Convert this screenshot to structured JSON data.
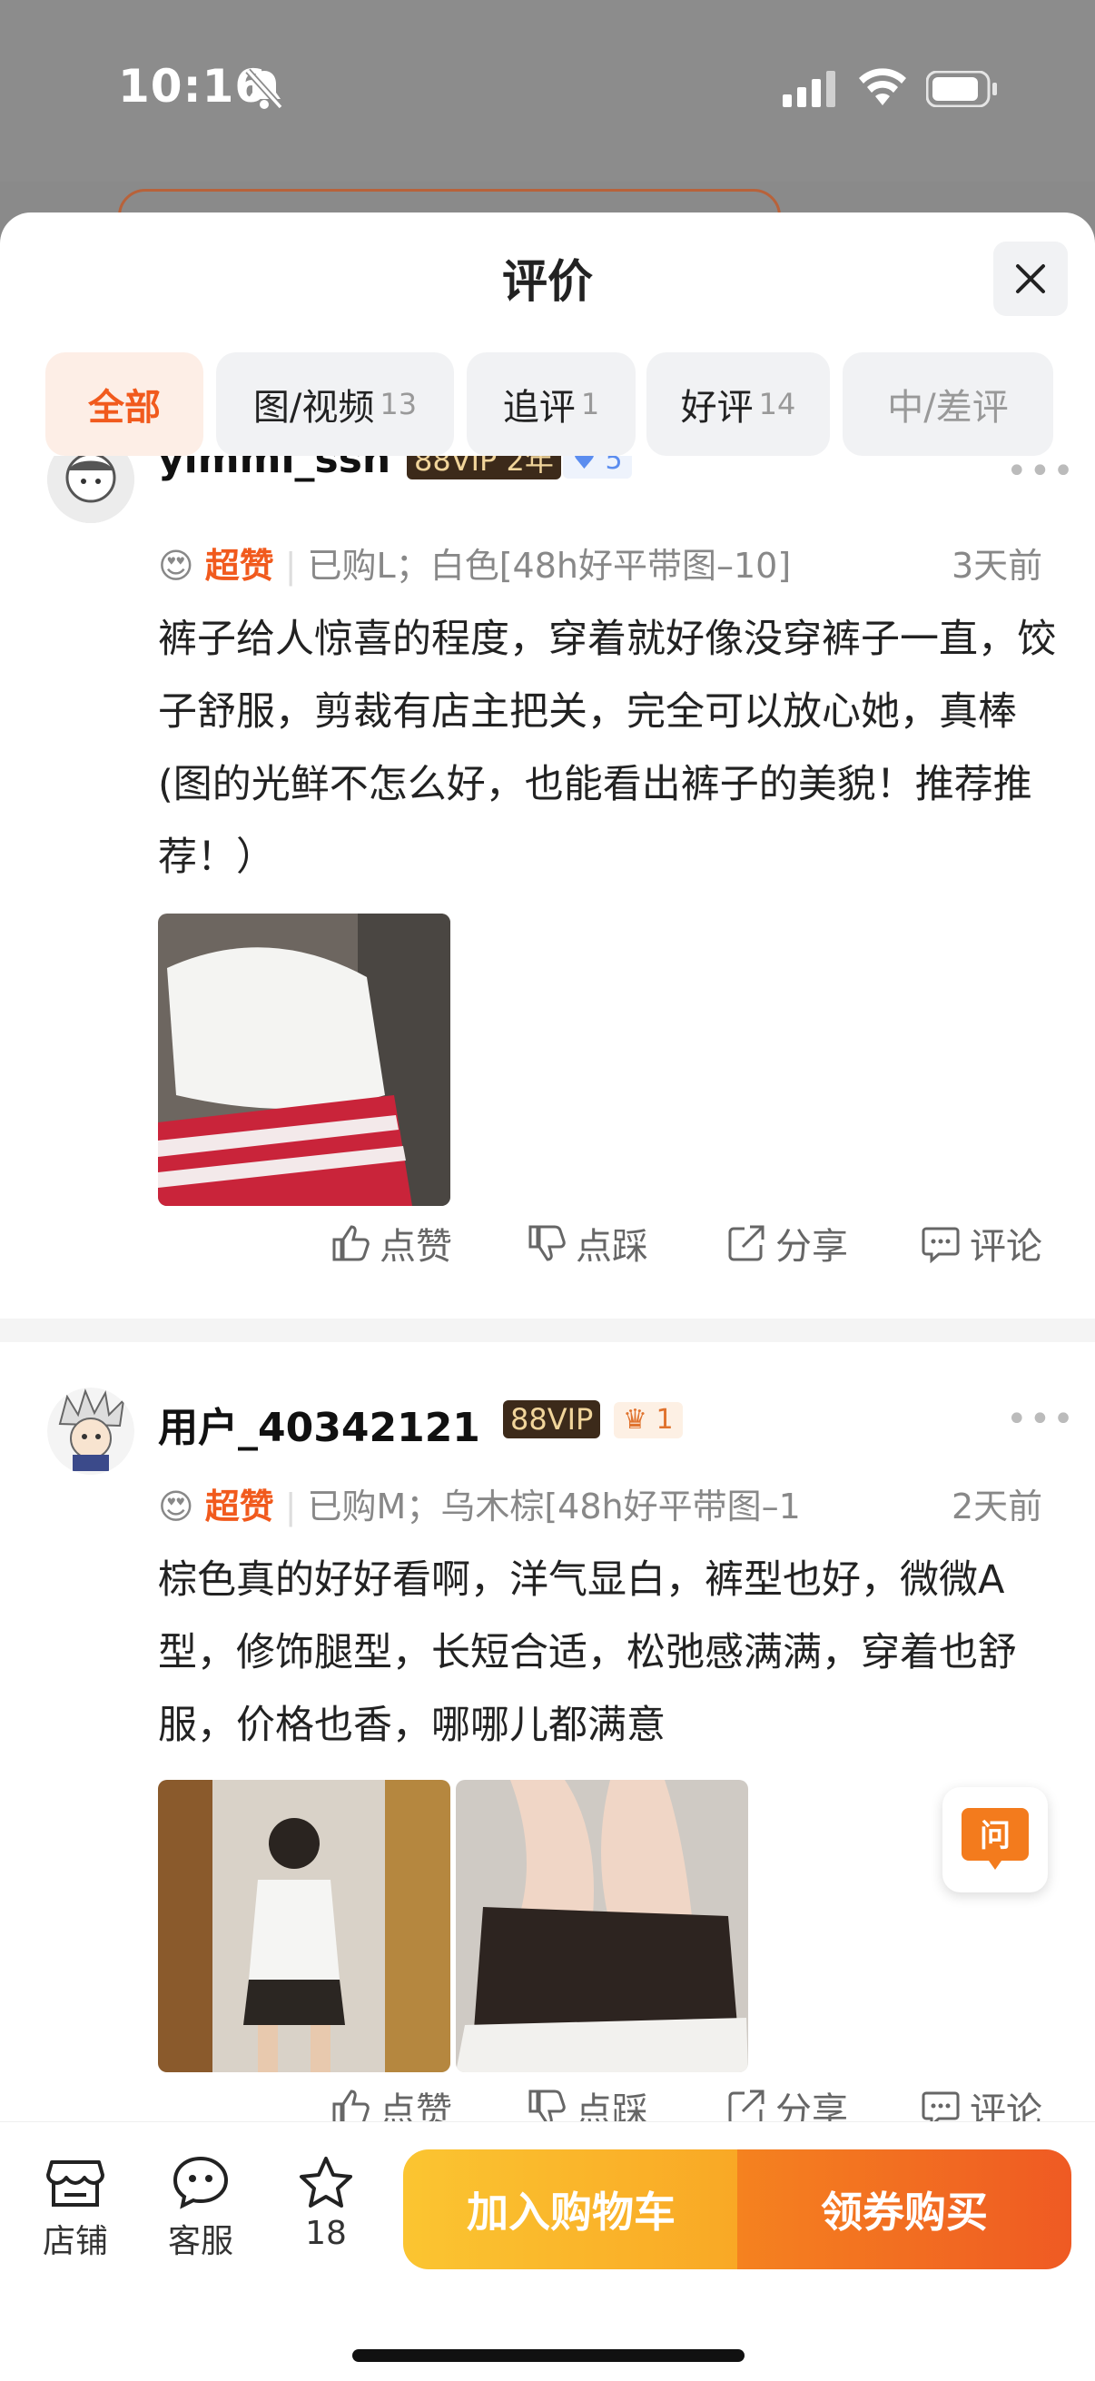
{
  "status": {
    "time": "10:16"
  },
  "sheet": {
    "title": "评价",
    "tabs": [
      {
        "label": "全部",
        "count": ""
      },
      {
        "label": "图/视频",
        "count": "13"
      },
      {
        "label": "追评",
        "count": "1"
      },
      {
        "label": "好评",
        "count": "14"
      },
      {
        "label": "中/差评",
        "count": ""
      }
    ]
  },
  "reviews": [
    {
      "username": "yimmi_ssn",
      "vip": "88VIP",
      "vip_years": "2年",
      "level": "5",
      "badge": "超赞",
      "purchase": "已购L；白色[48h好平带图–10]",
      "time": "3天前",
      "text": "裤子给人惊喜的程度，穿着就好像没穿裤子一直，饺子舒服，剪裁有店主把关，完全可以放心她，真棒(图的光鲜不怎么好，也能看出裤子的美貌！推荐推荐！）"
    },
    {
      "username": "用户_40342121",
      "vip": "88VIP",
      "level": "1",
      "badge": "超赞",
      "purchase": "已购M；乌木棕[48h好平带图–1",
      "time": "2天前",
      "text": "棕色真的好好看啊，洋气显白，裤型也好，微微A型，修饰腿型，长短合适，松弛感满满，穿着也舒服，价格也香，哪哪儿都满意"
    }
  ],
  "actions": {
    "like": "点赞",
    "dislike": "点踩",
    "share": "分享",
    "comment": "评论"
  },
  "float_button": "问",
  "bottom_bar": {
    "shop": "店铺",
    "service": "客服",
    "favorites": "18",
    "add_to_cart": "加入购物车",
    "coupon_buy": "领券购买"
  }
}
